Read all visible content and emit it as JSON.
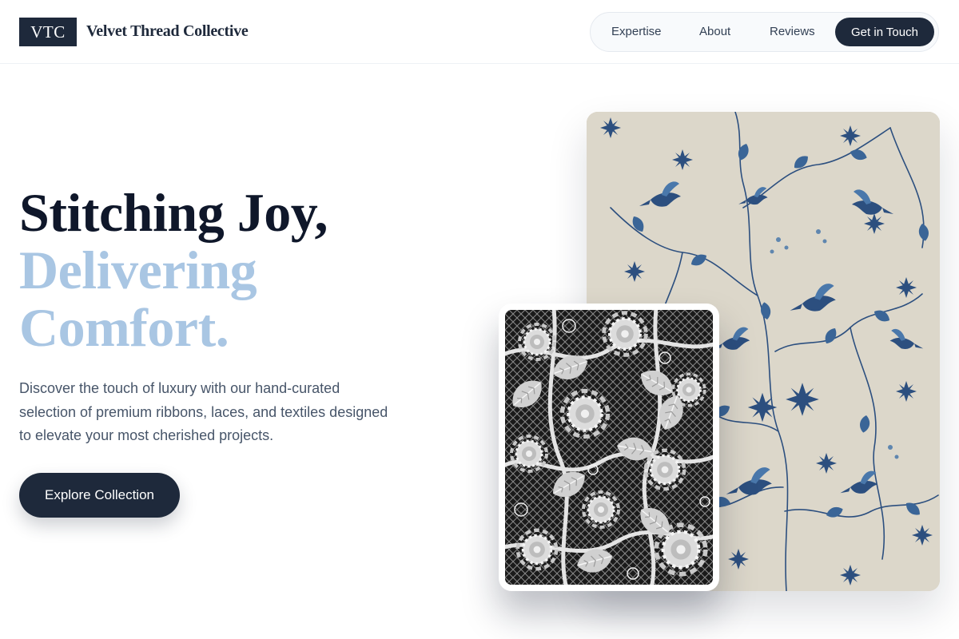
{
  "brand": {
    "logo_text": "VTC",
    "name": "Velvet Thread Collective"
  },
  "nav": {
    "links": [
      "Expertise",
      "About",
      "Reviews"
    ],
    "cta": "Get in Touch"
  },
  "hero": {
    "headline_line1": "Stitching Joy,",
    "headline_line2": "Delivering",
    "headline_line3": "Comfort.",
    "description": "Discover the touch of luxury with our hand-curated selection of premium ribbons, laces, and textiles designed to elevate your most cherished projects.",
    "button_label": "Explore Collection"
  },
  "images": {
    "floral": "floral-print-fabric-image",
    "lace": "white-lace-fabric-image"
  },
  "colors": {
    "primary": "#1e293b",
    "accent": "#a9c6e3",
    "floral_ground": "#d9d3c6",
    "floral_ink": "#2c4f7f"
  }
}
